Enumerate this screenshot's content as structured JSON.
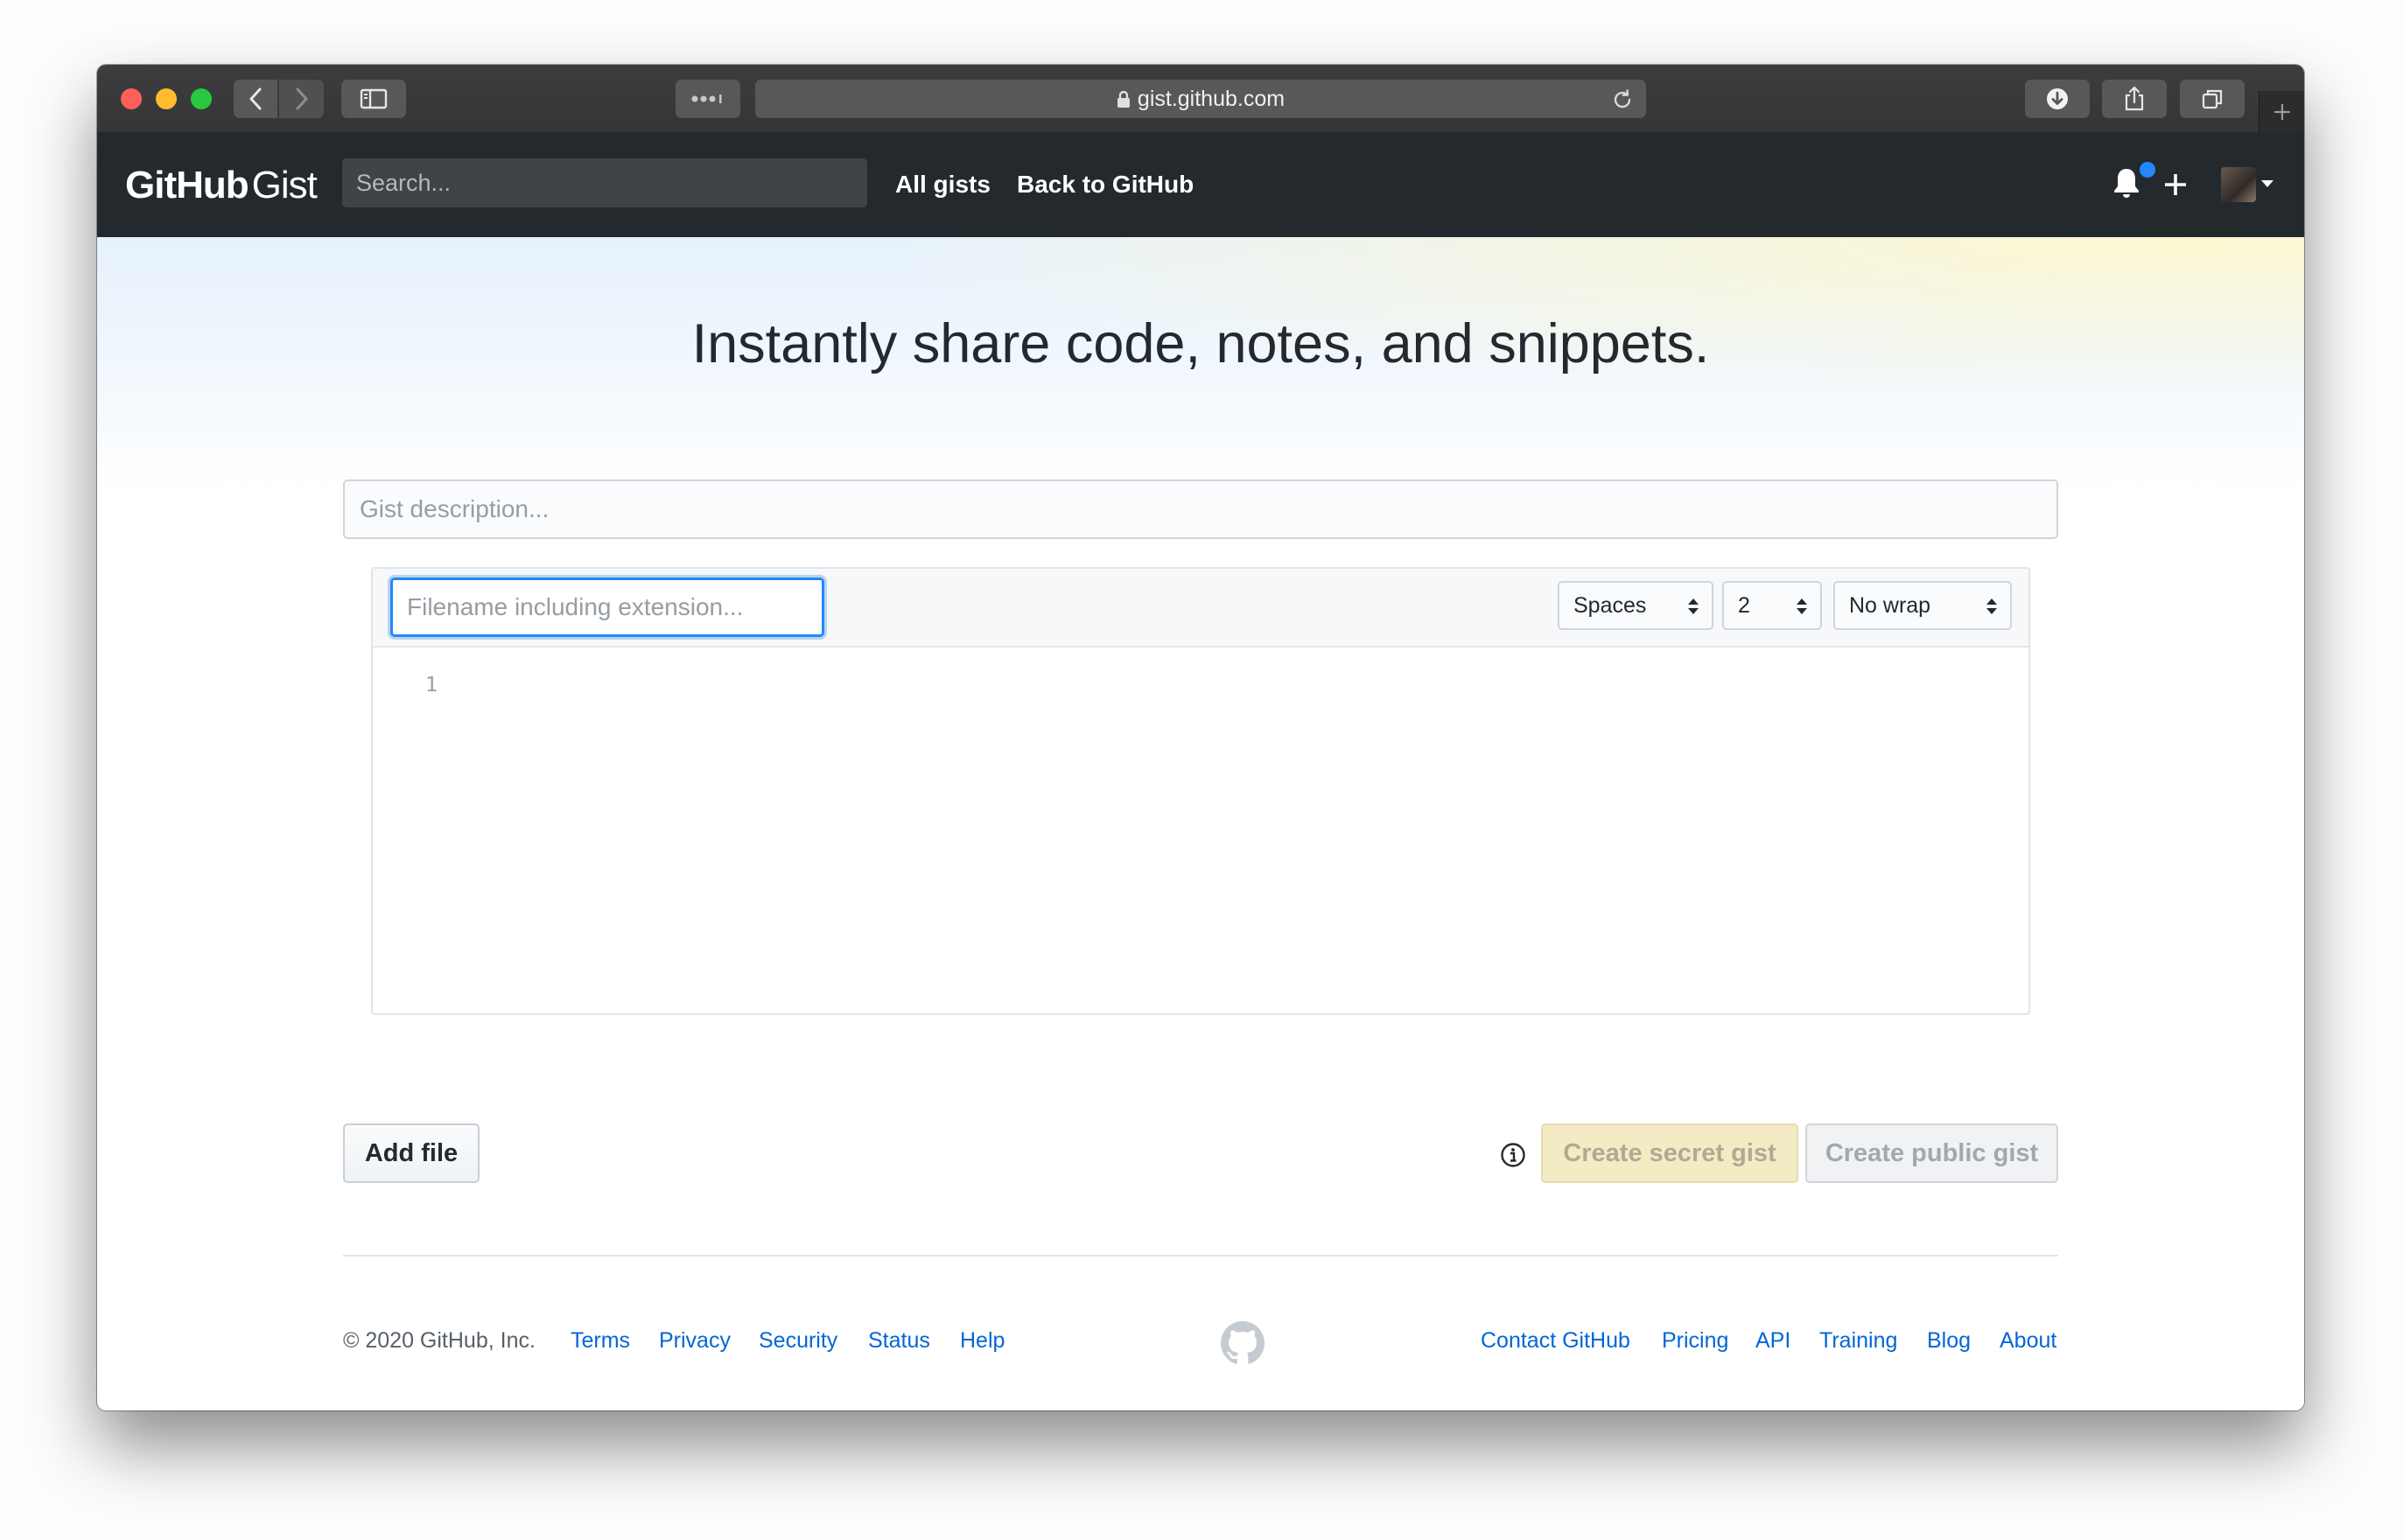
{
  "browser": {
    "address": "gist.github.com"
  },
  "header": {
    "logo_bold": "GitHub",
    "logo_light": "Gist",
    "search_placeholder": "Search...",
    "nav": [
      "All gists",
      "Back to GitHub"
    ],
    "notification_unread": true
  },
  "hero": {
    "title": "Instantly share code, notes, and snippets."
  },
  "form": {
    "description_placeholder": "Gist description...",
    "file": {
      "filename_placeholder": "Filename including extension...",
      "indent_mode": "Spaces",
      "indent_size": "2",
      "wrap_mode": "No wrap",
      "line_numbers": [
        "1"
      ]
    },
    "add_file_label": "Add file",
    "create_secret_label": "Create secret gist",
    "create_public_label": "Create public gist"
  },
  "footer": {
    "copyright": "© 2020 GitHub, Inc.",
    "left_links": [
      "Terms",
      "Privacy",
      "Security",
      "Status",
      "Help"
    ],
    "right_links": [
      "Contact GitHub",
      "Pricing",
      "API",
      "Training",
      "Blog",
      "About"
    ]
  },
  "colors": {
    "header_bg": "#24292e",
    "link": "#0366d6",
    "focus": "#2188ff",
    "notification_dot": "#2188ff"
  }
}
